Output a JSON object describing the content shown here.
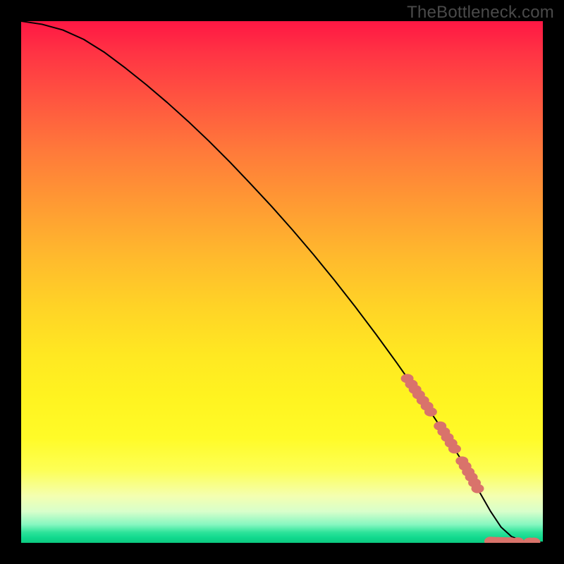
{
  "watermark": "TheBottleneck.com",
  "chart_data": {
    "type": "line",
    "title": "",
    "xlabel": "",
    "ylabel": "",
    "xlim": [
      0,
      100
    ],
    "ylim": [
      0,
      100
    ],
    "grid": false,
    "background": "rainbow-gradient-vertical",
    "series": [
      {
        "name": "curve",
        "x": [
          0,
          4,
          8,
          12,
          16,
          20,
          24,
          28,
          32,
          36,
          40,
          44,
          48,
          52,
          56,
          60,
          64,
          68,
          72,
          76,
          80,
          84,
          88,
          90,
          92,
          94,
          96,
          98,
          100
        ],
        "y": [
          100,
          99.4,
          98.3,
          96.5,
          94.0,
          91.0,
          87.8,
          84.4,
          80.8,
          77.0,
          73.0,
          68.8,
          64.5,
          60.0,
          55.3,
          50.4,
          45.3,
          40.0,
          34.5,
          28.8,
          22.8,
          16.5,
          9.5,
          6.0,
          3.0,
          1.2,
          0.4,
          0.15,
          0.1
        ]
      }
    ],
    "highlighted_points": {
      "name": "markers",
      "points": [
        {
          "x": 74.0,
          "y": 31.5
        },
        {
          "x": 74.8,
          "y": 30.4
        },
        {
          "x": 75.5,
          "y": 29.4
        },
        {
          "x": 76.2,
          "y": 28.4
        },
        {
          "x": 77.0,
          "y": 27.3
        },
        {
          "x": 77.8,
          "y": 26.2
        },
        {
          "x": 78.5,
          "y": 25.1
        },
        {
          "x": 80.3,
          "y": 22.4
        },
        {
          "x": 81.0,
          "y": 21.3
        },
        {
          "x": 81.7,
          "y": 20.2
        },
        {
          "x": 82.4,
          "y": 19.1
        },
        {
          "x": 83.1,
          "y": 18.0
        },
        {
          "x": 84.5,
          "y": 15.7
        },
        {
          "x": 85.1,
          "y": 14.7
        },
        {
          "x": 85.7,
          "y": 13.6
        },
        {
          "x": 86.3,
          "y": 12.6
        },
        {
          "x": 86.9,
          "y": 11.5
        },
        {
          "x": 87.5,
          "y": 10.4
        },
        {
          "x": 90.0,
          "y": 0.3
        },
        {
          "x": 90.7,
          "y": 0.27
        },
        {
          "x": 91.4,
          "y": 0.25
        },
        {
          "x": 92.0,
          "y": 0.23
        },
        {
          "x": 92.6,
          "y": 0.22
        },
        {
          "x": 93.2,
          "y": 0.21
        },
        {
          "x": 93.8,
          "y": 0.2
        },
        {
          "x": 95.2,
          "y": 0.18
        },
        {
          "x": 97.5,
          "y": 0.14
        },
        {
          "x": 98.3,
          "y": 0.13
        }
      ]
    }
  }
}
